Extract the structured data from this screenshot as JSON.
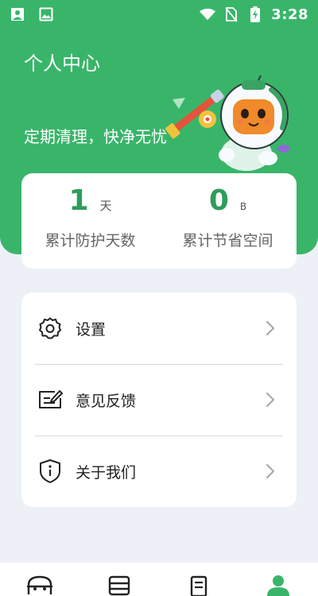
{
  "status_bar": {
    "time": "3:28",
    "icons": [
      "person-notification-icon",
      "image-notification-icon",
      "wifi-icon",
      "no-sim-icon",
      "battery-charging-icon"
    ]
  },
  "header": {
    "title": "个人中心",
    "slogan": "定期清理，快净无忧"
  },
  "stats": [
    {
      "value": "1",
      "unit": "天",
      "label": "累计防护天数"
    },
    {
      "value": "0",
      "unit": "B",
      "label": "累计节省空间"
    }
  ],
  "menu": [
    {
      "label": "设置",
      "icon": "gear-icon"
    },
    {
      "label": "意见反馈",
      "icon": "feedback-icon"
    },
    {
      "label": "关于我们",
      "icon": "info-shield-icon"
    }
  ],
  "tabbar": {
    "tabs": [
      {
        "icon": "robot-icon",
        "active": false
      },
      {
        "icon": "storage-icon",
        "active": false
      },
      {
        "icon": "document-icon",
        "active": false
      },
      {
        "icon": "profile-icon",
        "active": true
      }
    ]
  },
  "colors": {
    "primary": "#39b56a",
    "background": "#eef0f7",
    "accent_text": "#2f9c5a"
  }
}
